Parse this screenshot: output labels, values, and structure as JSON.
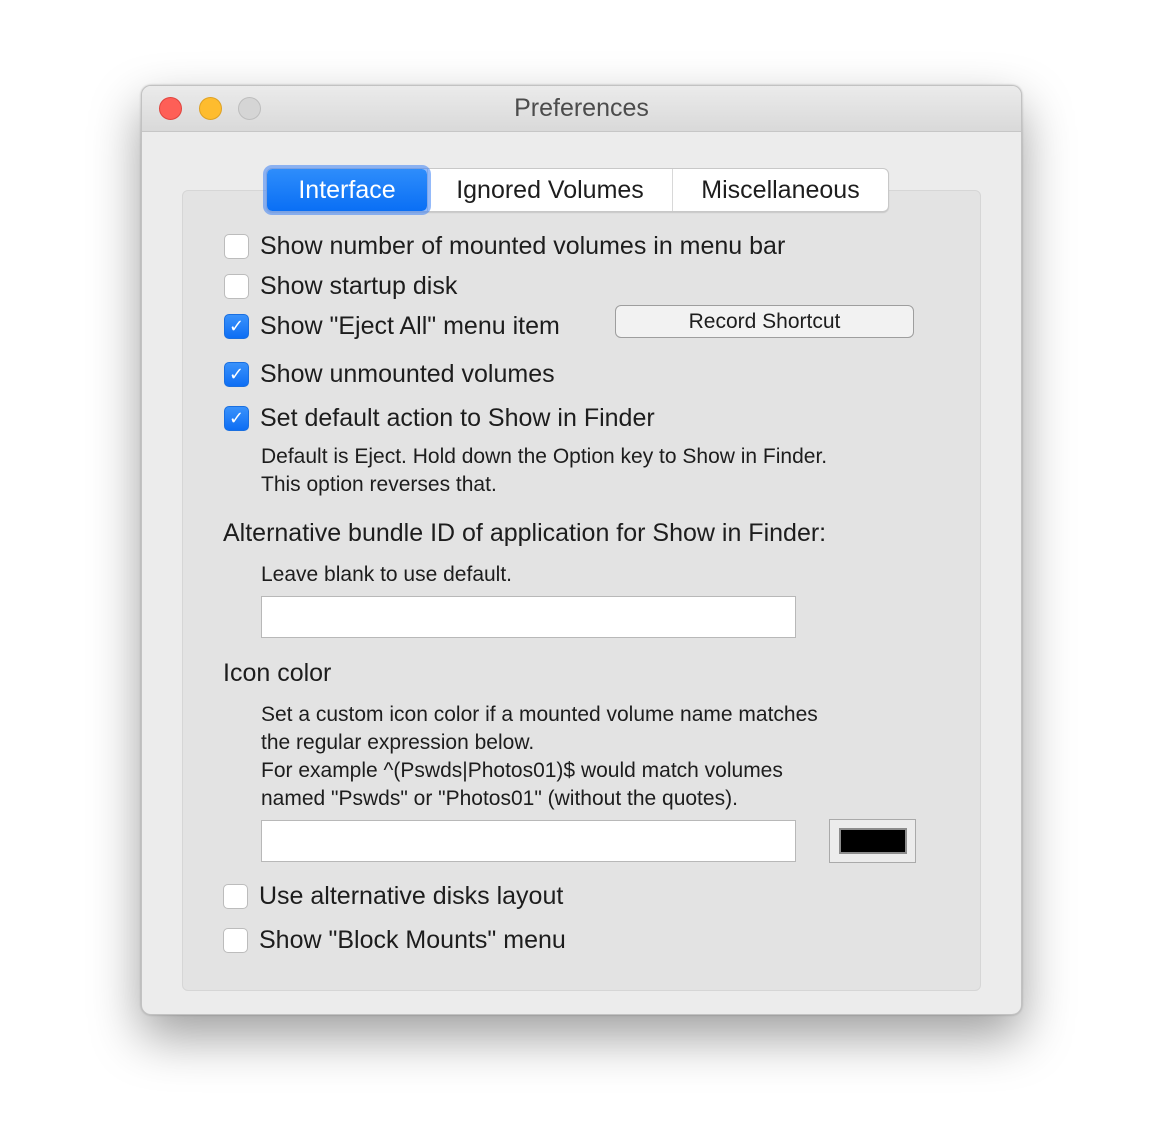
{
  "window": {
    "title": "Preferences",
    "controls": [
      "close",
      "minimize",
      "zoom"
    ]
  },
  "tabs": [
    {
      "label": "Interface",
      "active": true
    },
    {
      "label": "Ignored Volumes",
      "active": false
    },
    {
      "label": "Miscellaneous",
      "active": false
    }
  ],
  "options": {
    "show_count": {
      "label": "Show number of mounted volumes in menu bar",
      "checked": false
    },
    "show_startup": {
      "label": "Show startup disk",
      "checked": false
    },
    "show_eject_all": {
      "label": "Show \"Eject All\" menu item",
      "checked": true
    },
    "show_unmounted": {
      "label": "Show unmounted volumes",
      "checked": true
    },
    "default_action": {
      "label": "Set default action to Show in Finder",
      "checked": true
    },
    "alt_layout": {
      "label": "Use alternative disks layout",
      "checked": false
    },
    "block_mounts": {
      "label": "Show \"Block Mounts\" menu",
      "checked": false
    }
  },
  "record_shortcut_label": "Record Shortcut",
  "default_action_help": [
    "Default is Eject. Hold down the Option key to Show in Finder.",
    "This option reverses that."
  ],
  "bundle": {
    "heading": "Alternative bundle ID of application for Show in Finder:",
    "help": "Leave blank to use default.",
    "value": "",
    "placeholder": ""
  },
  "icon_color": {
    "heading": "Icon color",
    "help": [
      "Set a custom icon color if a mounted volume name matches",
      "the regular expression below.",
      "For example ^(Pswds|Photos01)$ would match volumes",
      "named \"Pswds\" or \"Photos01\" (without the quotes)."
    ],
    "regex_value": "",
    "color": "#000000"
  },
  "checkmark_glyph": "✓"
}
